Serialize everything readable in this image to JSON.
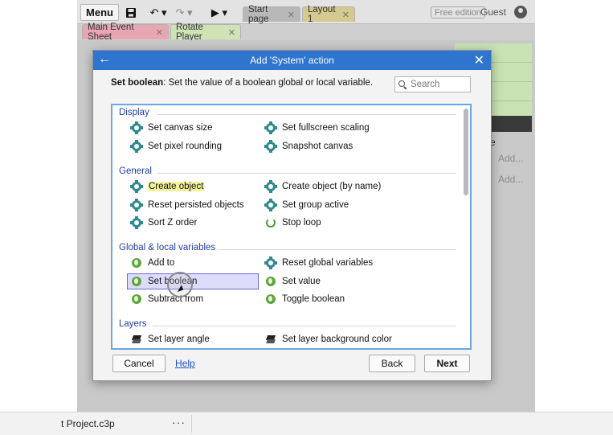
{
  "toolbar": {
    "menu_label": "Menu",
    "tabs": [
      {
        "label": "Start page"
      },
      {
        "label": "Layout 1"
      }
    ],
    "edition_badge": "Free edition",
    "user": "Guest"
  },
  "sheet_tabs": [
    {
      "label": "Main Event Sheet"
    },
    {
      "label": "Rotate Player"
    }
  ],
  "workspace": {
    "add_links": [
      "Add...",
      "Add..."
    ],
    "fragment": "e"
  },
  "taskbar": {
    "project_name": "t Project.c3p",
    "more": "···"
  },
  "dialog": {
    "title": "Add 'System' action",
    "back_glyph": "←",
    "close_glyph": "✕",
    "desc_bold": "Set boolean",
    "desc_rest": ": Set the value of a boolean global or local variable.",
    "search_placeholder": "Search",
    "categories": [
      {
        "name": "Display",
        "items": [
          {
            "label": "Set canvas size",
            "icon": "gear-icon"
          },
          {
            "label": "Set fullscreen scaling",
            "icon": "gear-icon"
          },
          {
            "label": "Set pixel rounding",
            "icon": "gear-icon"
          },
          {
            "label": "Snapshot canvas",
            "icon": "gear-icon"
          }
        ]
      },
      {
        "name": "General",
        "items": [
          {
            "label": "Create object",
            "icon": "gear-icon",
            "highlighted": true
          },
          {
            "label": "Create object (by name)",
            "icon": "gear-icon"
          },
          {
            "label": "Reset persisted objects",
            "icon": "gear-icon"
          },
          {
            "label": "Set group active",
            "icon": "gear-icon"
          },
          {
            "label": "Sort Z order",
            "icon": "gear-icon"
          },
          {
            "label": "Stop loop",
            "icon": "loop-icon"
          }
        ]
      },
      {
        "name": "Global & local variables",
        "items": [
          {
            "label": "Add to",
            "icon": "globe-icon"
          },
          {
            "label": "Reset global variables",
            "icon": "gear-icon"
          },
          {
            "label": "Set boolean",
            "icon": "globe-icon",
            "selected": true
          },
          {
            "label": "Set value",
            "icon": "globe-icon"
          },
          {
            "label": "Subtract from",
            "icon": "globe-icon"
          },
          {
            "label": "Toggle boolean",
            "icon": "globe-icon"
          }
        ]
      },
      {
        "name": "Layers",
        "items": [
          {
            "label": "Set layer angle",
            "icon": "layers-icon"
          },
          {
            "label": "Set layer background color",
            "icon": "layers-icon"
          }
        ]
      }
    ],
    "buttons": {
      "cancel": "Cancel",
      "help": "Help",
      "back": "Back",
      "next": "Next"
    }
  },
  "colors": {
    "titlebar": "#2f75cf",
    "category_text": "#1f3ea8",
    "gear_icon": "#2f8a8f",
    "globe_icon": "#5ea53c",
    "selection_border": "#6a6ad8",
    "highlight": "#f4f29a"
  }
}
